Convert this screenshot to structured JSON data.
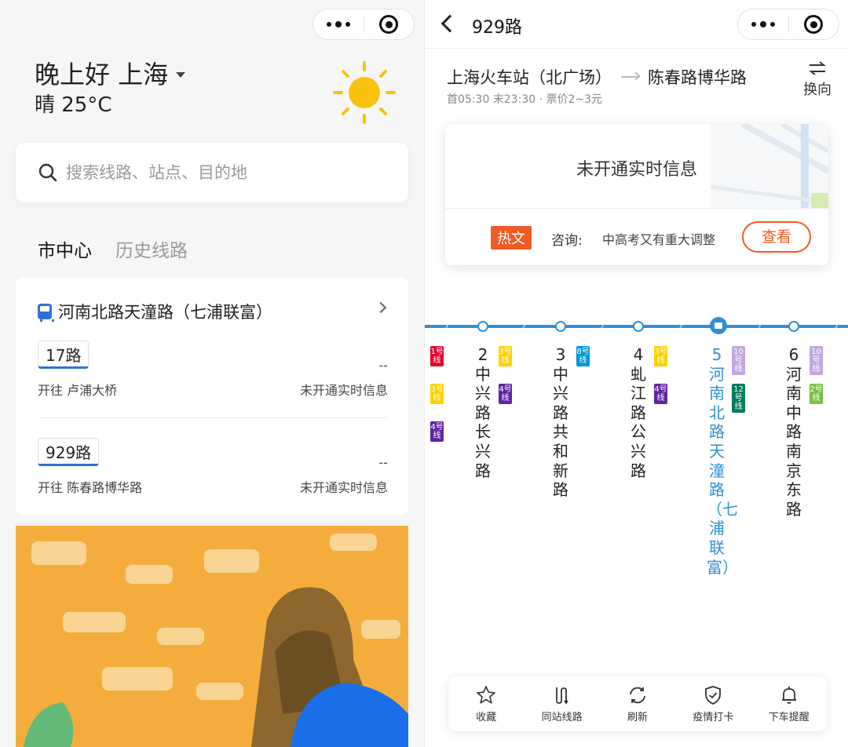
{
  "left": {
    "greeting": "晚上好 上海",
    "weather": "晴 25°C",
    "search_placeholder": "搜索线路、站点、目的地",
    "tabs": [
      "市中心",
      "历史线路"
    ],
    "station_name": "河南北路天潼路（七浦联富）",
    "routes": [
      {
        "name": "17路",
        "direction": "开往 卢浦大桥",
        "eta": "--",
        "status": "未开通实时信息"
      },
      {
        "name": "929路",
        "direction": "开往 陈春路博华路",
        "eta": "--",
        "status": "未开通实时信息"
      }
    ]
  },
  "right": {
    "title": "929路",
    "from": "上海火车站（北广场）",
    "to": "陈春路博华路",
    "info": "首05:30 末23:30 · 票价2~3元",
    "swap_label": "换向",
    "realtime_msg": "未开通实时信息",
    "hot_tag": "热文",
    "consult_label": "咨询:",
    "consult_text": "中高考又有重大调整",
    "view_button": "查看",
    "stops": [
      {
        "index": "",
        "name": "",
        "metro": [
          {
            "line": "1号线",
            "color": "#e3002b"
          },
          {
            "line": "3号线",
            "color": "#ffd100"
          },
          {
            "line": "4号线",
            "color": "#5f259f"
          }
        ]
      },
      {
        "index": "2",
        "name": "中兴路长兴路",
        "metro": [
          {
            "line": "3号线",
            "color": "#ffd100"
          },
          {
            "line": "4号线",
            "color": "#5f259f"
          }
        ]
      },
      {
        "index": "3",
        "name": "中兴路共和新路",
        "metro": [
          {
            "line": "8号线",
            "color": "#0094d8"
          }
        ]
      },
      {
        "index": "4",
        "name": "虬江路公兴路",
        "metro": [
          {
            "line": "3号线",
            "color": "#ffd100"
          },
          {
            "line": "4号线",
            "color": "#5f259f"
          }
        ]
      },
      {
        "index": "5",
        "name": "河南北路天潼路（七浦联富）",
        "current": true,
        "metro": [
          {
            "line": "10号线",
            "color": "#c1a7e2"
          },
          {
            "line": "12号线",
            "color": "#007b5f"
          }
        ]
      },
      {
        "index": "6",
        "name": "河南中路南京东路",
        "metro": [
          {
            "line": "10号线",
            "color": "#c1a7e2"
          },
          {
            "line": "2号线",
            "color": "#78c043"
          }
        ]
      }
    ],
    "bottom_nav": [
      {
        "label": "收藏",
        "icon": "star-icon"
      },
      {
        "label": "同站线路",
        "icon": "same-station-icon"
      },
      {
        "label": "刷新",
        "icon": "refresh-icon"
      },
      {
        "label": "疫情打卡",
        "icon": "shield-check-icon"
      },
      {
        "label": "下车提醒",
        "icon": "bell-icon"
      }
    ]
  },
  "colors": {
    "accent_blue": "#2f8fd6",
    "hot_orange": "#f15a24",
    "sun_yellow": "#f9c10f"
  }
}
